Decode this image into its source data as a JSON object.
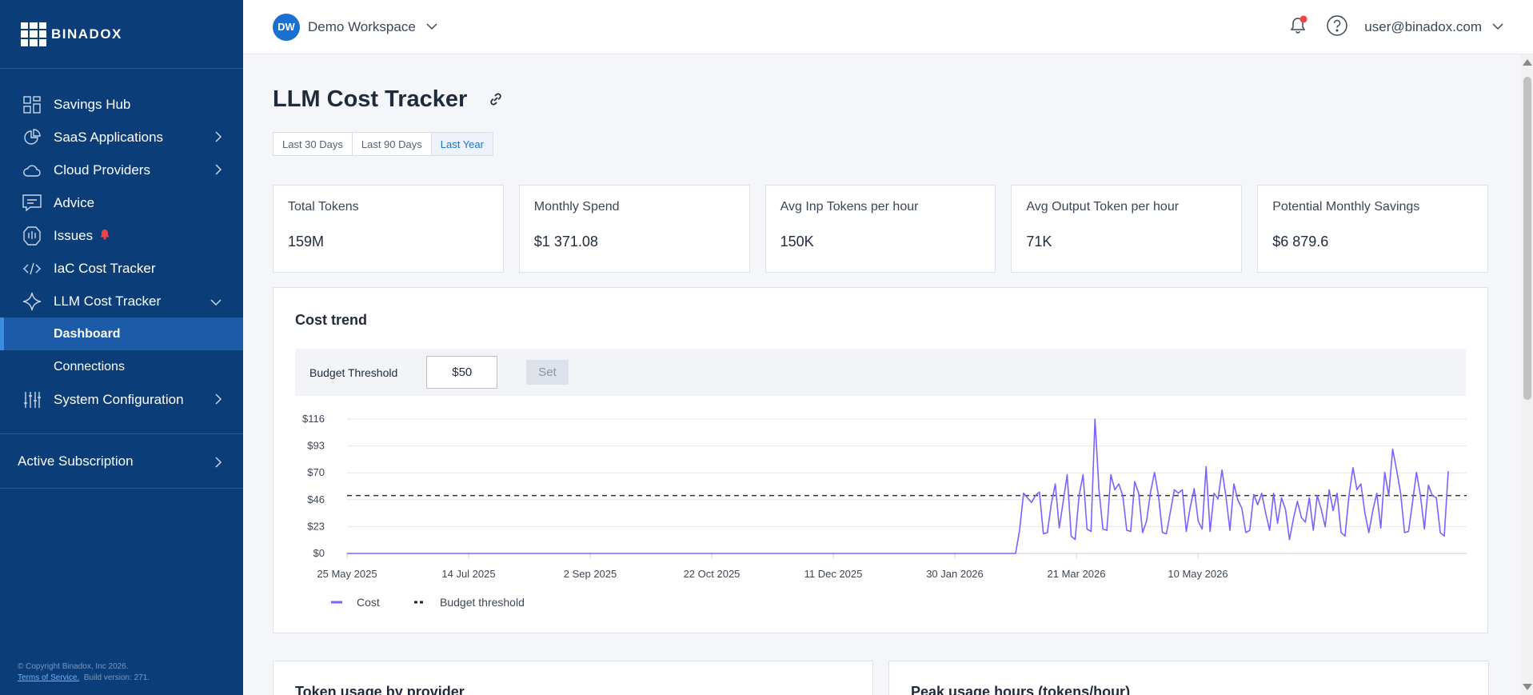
{
  "brand": {
    "name": "BINADOX"
  },
  "sidebar": {
    "items": [
      {
        "label": "Savings Hub",
        "icon": "dashboard-grid-icon"
      },
      {
        "label": "SaaS Applications",
        "icon": "pie-chart-icon"
      },
      {
        "label": "Cloud Providers",
        "icon": "cloud-icon"
      },
      {
        "label": "Advice",
        "icon": "message-icon"
      },
      {
        "label": "Issues",
        "icon": "shield-icon"
      },
      {
        "label": "IaC Cost Tracker",
        "icon": "code-icon"
      },
      {
        "label": "LLM Cost Tracker",
        "icon": "sparkle-icon"
      },
      {
        "label": "System Configuration",
        "icon": "sliders-icon"
      }
    ],
    "sub_items": [
      "Dashboard",
      "Connections"
    ],
    "active_subscription": "Active Subscription",
    "footer": {
      "copyright": "© Copyright Binadox, Inc 2026.",
      "terms": "Terms of Service.",
      "build": "Build version: 271."
    }
  },
  "header": {
    "workspace_initials": "DW",
    "workspace_name": "Demo Workspace",
    "user_email": "user@binadox.com"
  },
  "page": {
    "title": "LLM Cost Tracker",
    "ranges": [
      "Last 30 Days",
      "Last 90 Days",
      "Last Year"
    ],
    "active_range": "Last Year"
  },
  "kpis": [
    {
      "label": "Total Tokens",
      "value": "159M"
    },
    {
      "label": "Monthly Spend",
      "value": "$1 371.08"
    },
    {
      "label": "Avg Inp Tokens per hour",
      "value": "150K"
    },
    {
      "label": "Avg Output Token per hour",
      "value": "71K"
    },
    {
      "label": "Potential Monthly Savings",
      "value": "$6 879.6"
    }
  ],
  "trend": {
    "title": "Cost trend",
    "threshold_label": "Budget Threshold",
    "threshold_value": "$50",
    "set_label": "Set"
  },
  "bottom_cards": [
    "Token usage by provider",
    "Peak usage hours (tokens/hour)"
  ],
  "colors": {
    "sidebar": "#0b3d78",
    "accent": "#1b6fd0",
    "series": "#7b61ff",
    "alert": "#f04444"
  },
  "chart_data": {
    "type": "line",
    "y_ticks": [
      "$116",
      "$93",
      "$70",
      "$46",
      "$23",
      "$0"
    ],
    "x_ticks": [
      "25 May 2025",
      "14 Jul 2025",
      "2 Sep 2025",
      "22 Oct 2025",
      "11 Dec 2025",
      "30 Jan 2026",
      "21 Mar 2026",
      "10 May 2026"
    ],
    "ylim": [
      0,
      116
    ],
    "x_start": "2025-05-25",
    "threshold": 50,
    "legend": [
      "Cost",
      "Budget threshold"
    ],
    "flat_until": "2026-02-24",
    "series": [
      {
        "name": "Cost",
        "values_from_2026_02_24": [
          0,
          20,
          52,
          48,
          44,
          50,
          53,
          17,
          18,
          43,
          60,
          22,
          45,
          68,
          15,
          12,
          50,
          68,
          21,
          19,
          116,
          55,
          21,
          20,
          68,
          55,
          60,
          50,
          20,
          19,
          62,
          52,
          18,
          28,
          53,
          70,
          50,
          18,
          17,
          36,
          55,
          52,
          55,
          19,
          40,
          56,
          28,
          21,
          75,
          19,
          52,
          47,
          72,
          49,
          20,
          60,
          46,
          39,
          18,
          20,
          51,
          42,
          52,
          35,
          20,
          52,
          26,
          48,
          38,
          12,
          30,
          45,
          31,
          27,
          48,
          20,
          50,
          38,
          23,
          55,
          37,
          52,
          18,
          15,
          50,
          74,
          55,
          60,
          35,
          18,
          37,
          52,
          22,
          70,
          50,
          90,
          72,
          52,
          18,
          19,
          44,
          70,
          50,
          21,
          59,
          50,
          48,
          18,
          15,
          71
        ]
      }
    ]
  }
}
